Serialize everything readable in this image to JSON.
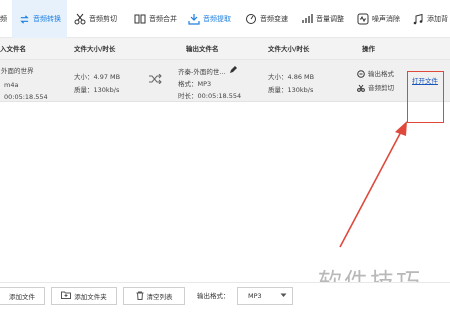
{
  "toolbar": {
    "items": [
      {
        "label": "频"
      },
      {
        "label": "音频转换"
      },
      {
        "label": "音频剪切"
      },
      {
        "label": "音频合并"
      },
      {
        "label": "音频提取"
      },
      {
        "label": "音频变速"
      },
      {
        "label": "音量调整"
      },
      {
        "label": "噪声消除"
      },
      {
        "label": "添加背"
      }
    ],
    "accent": "#1e7fe0"
  },
  "table": {
    "headers": [
      "入文件名",
      "文件大小/时长",
      "输出文件名",
      "文件大小/时长",
      "操作"
    ],
    "row": {
      "input_name": "外面的世界",
      "input_ext": "m4a",
      "input_duration": "00:05:18.554",
      "size_label": "大小：4.97 MB",
      "quality_label": "质量：130kb/s",
      "out_name": "齐秦-外面的世...",
      "out_format": "格式：MP3",
      "out_duration": "时长：00:05:18.554",
      "out_size": "大小：4.86 MB",
      "out_quality": "质量：130kb/s",
      "op_format": "输出格式",
      "op_cut": "音频剪切",
      "op_open": "打开文件"
    }
  },
  "bottom": {
    "add_file": "添加文件",
    "add_folder": "添加文件夹",
    "clear_list": "清空列表",
    "format_label": "输出格式：",
    "format_value": "MP3"
  },
  "watermark": "软件技巧",
  "highlight_color": "#e0483c"
}
